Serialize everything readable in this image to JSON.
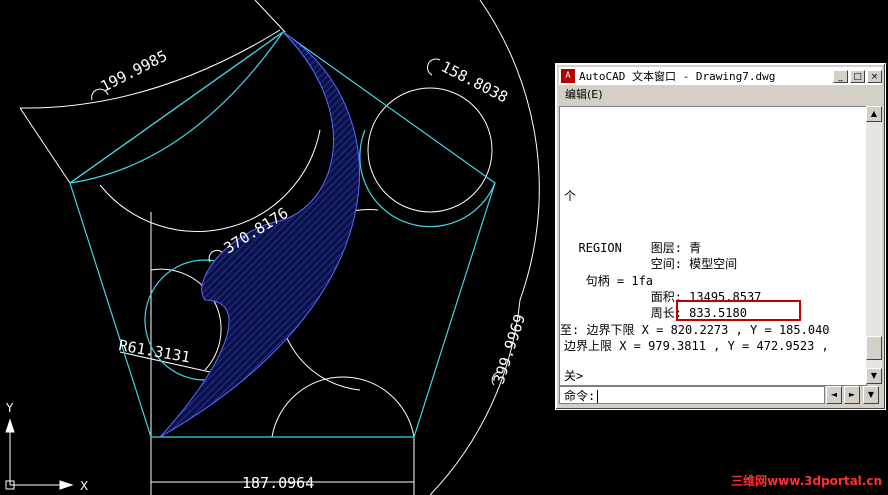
{
  "dimensions": {
    "d1": "199.9985",
    "d2": "158.8038",
    "d3": "370.8176",
    "d4": "399.9969",
    "d5": "R61.3131",
    "d6": "187.0964"
  },
  "axes": {
    "x_label": "X",
    "y_label": "Y"
  },
  "text_window": {
    "title": "AutoCAD 文本窗口 - Drawing7.dwg",
    "menu_edit": "编辑(E)",
    "buttons": {
      "minimize": "_",
      "maximize": "□",
      "close": "×"
    },
    "lines": {
      "l0": "个",
      "l1": "  REGION    图层: 青",
      "l2": "            空间: 模型空间",
      "l3": "   句柄 = 1fa",
      "l4": "            面积: 13495.8537",
      "l5": "            周长: 833.5180",
      "l6": "至: 边界下限 X = 820.2273 , Y = 185.040",
      "l7": "边界上限 X = 979.3811 , Y = 472.9523 ,",
      "l8": "关>"
    },
    "command_label": "命令:"
  },
  "watermark": "三维网www.3dportal.cn",
  "colors": {
    "cyan": "#3fd6e6",
    "hatch": "#1a237e",
    "background": "#000000"
  }
}
